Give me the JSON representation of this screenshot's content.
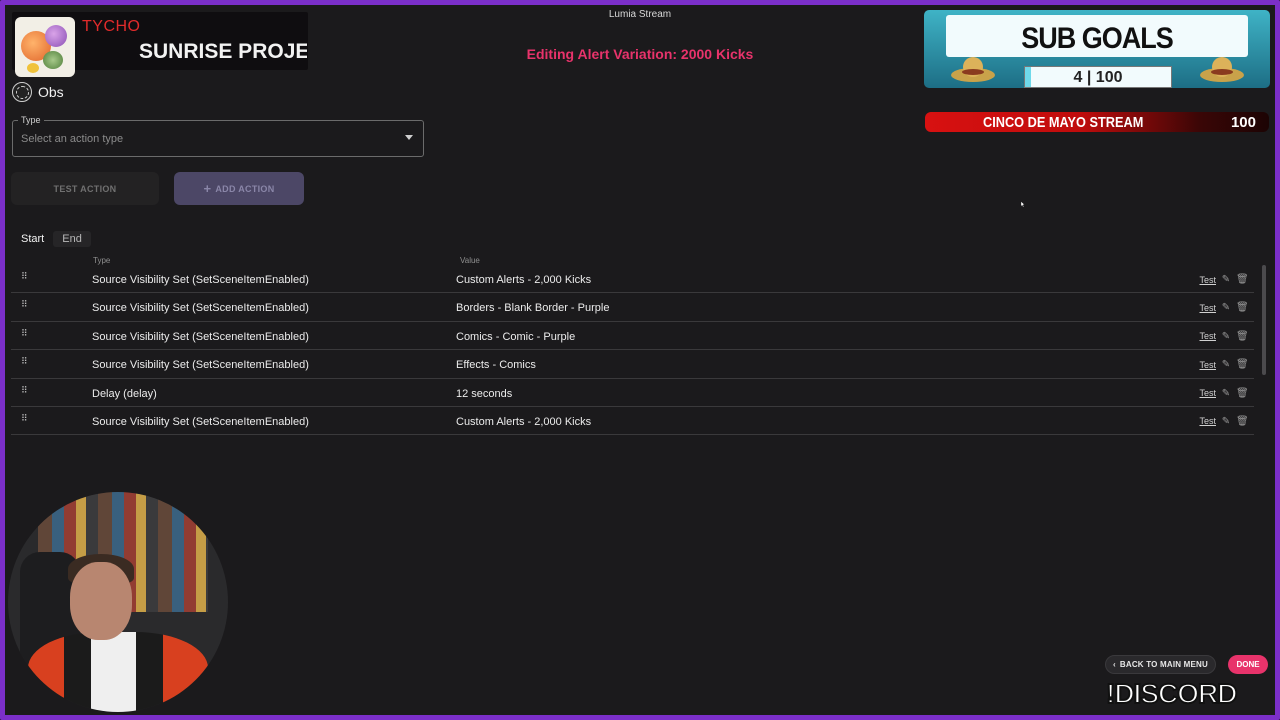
{
  "window": {
    "title": "Lumia Stream"
  },
  "page": {
    "heading": "Editing Alert Variation: 2000 Kicks"
  },
  "now_playing": {
    "artist": "TYCHO",
    "song": "SUNRISE PROJE"
  },
  "integration": {
    "name": "Obs",
    "icon": "obs-icon"
  },
  "type_field": {
    "label": "Type",
    "placeholder": "Select an action type"
  },
  "buttons": {
    "test_action": "TEST ACTION",
    "add_action": "ADD ACTION",
    "back": "BACK TO MAIN MENU",
    "done": "DONE"
  },
  "tabs": [
    {
      "label": "Start",
      "active": true
    },
    {
      "label": "End",
      "active": false
    }
  ],
  "table": {
    "headers": {
      "type": "Type",
      "value": "Value"
    },
    "rows": [
      {
        "type": "Source Visibility Set (SetSceneItemEnabled)",
        "value": "Custom Alerts - 2,000 Kicks",
        "test": "Test"
      },
      {
        "type": "Source Visibility Set (SetSceneItemEnabled)",
        "value": "Borders - Blank Border - Purple",
        "test": "Test"
      },
      {
        "type": "Source Visibility Set (SetSceneItemEnabled)",
        "value": "Comics - Comic - Purple",
        "test": "Test"
      },
      {
        "type": "Source Visibility Set (SetSceneItemEnabled)",
        "value": "Effects - Comics",
        "test": "Test"
      },
      {
        "type": "Delay (delay)",
        "value": "12 seconds",
        "test": "Test"
      },
      {
        "type": "Source Visibility Set (SetSceneItemEnabled)",
        "value": "Custom Alerts - 2,000 Kicks",
        "test": "Test"
      }
    ]
  },
  "sub_goals": {
    "title": "SUB GOALS",
    "current": "4",
    "separator": "|",
    "goal": "100",
    "progress_fraction": 0.04
  },
  "cinco": {
    "label": "CINCO DE MAYO STREAM",
    "value": "100"
  },
  "discord": {
    "text": "!DISCORD"
  },
  "colors": {
    "accent": "#e8336b",
    "frame": "#7b2fc9",
    "background": "#1b1a1c"
  }
}
